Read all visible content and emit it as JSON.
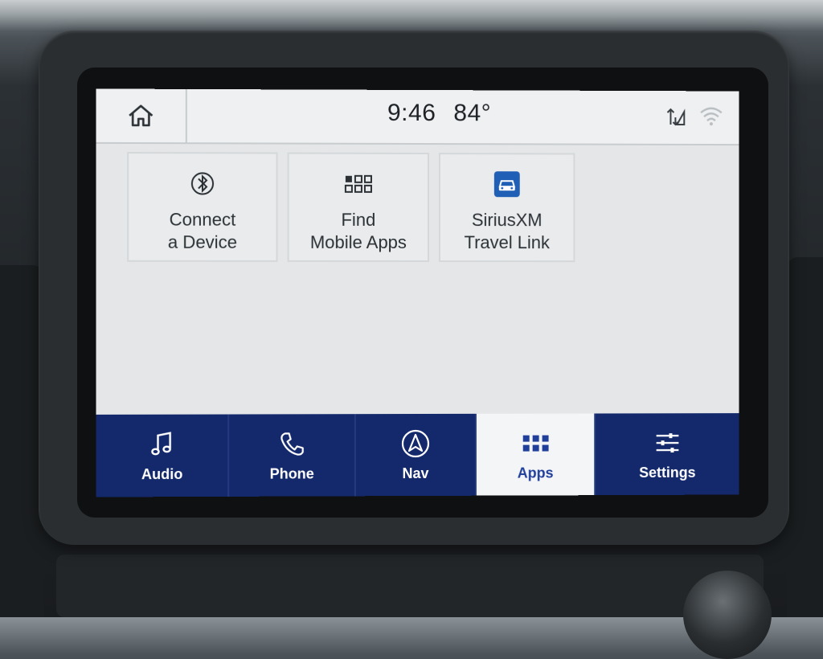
{
  "status_bar": {
    "time": "9:46",
    "temperature": "84°",
    "home_icon": "home-icon",
    "right_icons": [
      "data-transfer-icon",
      "wifi-icon"
    ]
  },
  "apps": {
    "tiles": [
      {
        "label": "Connect\na Device",
        "icon": "bluetooth-icon"
      },
      {
        "label": "Find\nMobile Apps",
        "icon": "app-grid-icon"
      },
      {
        "label": "SiriusXM\nTravel Link",
        "icon": "car-icon"
      }
    ]
  },
  "bottom_nav": {
    "items": [
      {
        "label": "Audio",
        "icon": "music-note-icon",
        "active": false
      },
      {
        "label": "Phone",
        "icon": "phone-icon",
        "active": false
      },
      {
        "label": "Nav",
        "icon": "navigation-arrow-icon",
        "active": false
      },
      {
        "label": "Apps",
        "icon": "app-grid-icon",
        "active": true
      },
      {
        "label": "Settings",
        "icon": "sliders-icon",
        "active": false
      }
    ]
  },
  "colors": {
    "nav_background": "#14296b",
    "active_accent": "#1f3f9a",
    "screen_background": "#e9ebec",
    "sirius_icon_bg": "#1f5fb5"
  }
}
